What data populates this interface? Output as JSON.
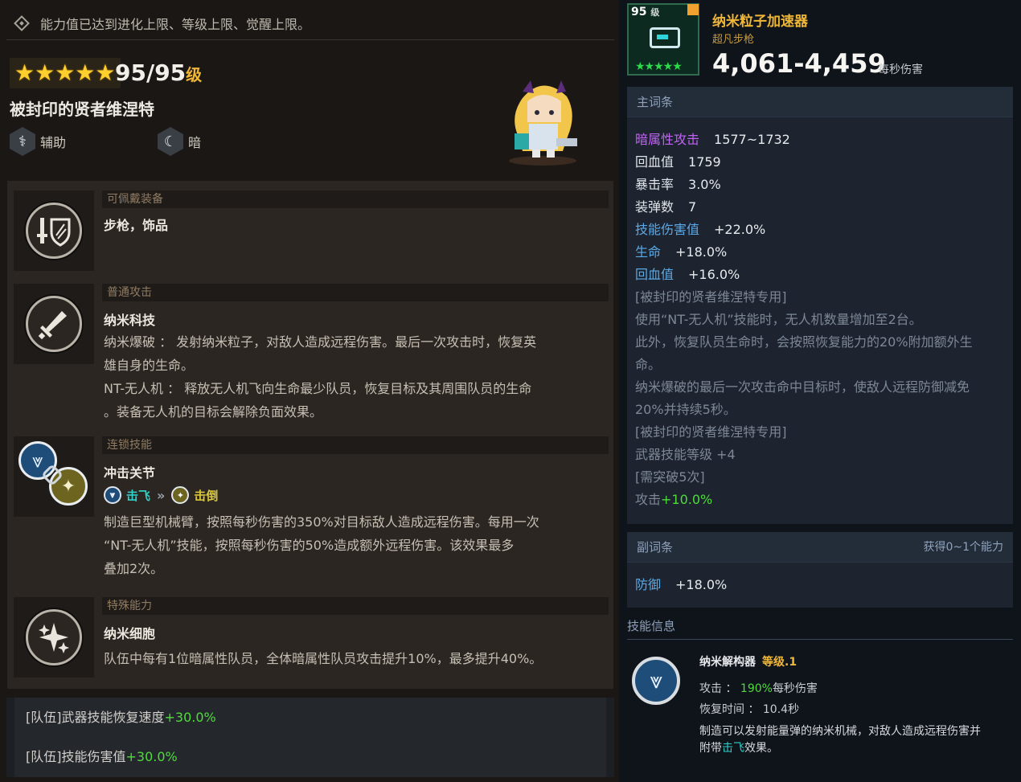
{
  "notice": "能力值已达到进化上限、等级上限、觉醒上限。",
  "hero": {
    "stars": "★★★★★",
    "level": "95/95",
    "level_unit": "级",
    "name": "被封印的贤者维涅特",
    "tags": [
      {
        "label": "辅助",
        "icon": "support-role-icon"
      },
      {
        "label": "暗",
        "icon": "dark-element-icon"
      }
    ]
  },
  "skills": [
    {
      "category": "可佩戴装备",
      "icon": "sword-shield-icon",
      "lines": [
        "步枪，饰品"
      ]
    },
    {
      "category": "普通攻击",
      "icon": "sword-icon",
      "title": "纳米科技",
      "lines": [
        "纳米爆破 ： 发射纳米粒子，对敌人造成远程伤害。最后一次攻击时，恢复英",
        "雄自身的生命。",
        "NT-无人机 ： 释放无人机飞向生命最少队员，恢复目标及其周围队员的生命",
        "。装备无人机的目标会解除负面效果。"
      ]
    },
    {
      "category": "连锁技能",
      "icon": "chain-skill-icon",
      "title": "冲击关节",
      "chain_from": "击飞",
      "chain_to": "击倒",
      "lines": [
        "制造巨型机械臂，按照每秒伤害的350%对目标敌人造成远程伤害。每用一次",
        "“NT-无人机”技能，按照每秒伤害的50%造成额外远程伤害。该效果最多",
        "叠加2次。"
      ]
    },
    {
      "category": "特殊能力",
      "icon": "sparkle-icon",
      "title": "纳米细胞",
      "lines": [
        "队伍中每有1位暗属性队员，全体暗属性队员攻击提升10%，最多提升40%。"
      ]
    }
  ],
  "party_bonuses": [
    {
      "label": "[队伍]武器技能恢复速度",
      "value": "+30.0%"
    },
    {
      "label": "[队伍]技能伤害值",
      "value": "+30.0%"
    }
  ],
  "weapon": {
    "level": "95",
    "level_unit": "级",
    "stars": "★★★★★",
    "name": "纳米粒子加速器",
    "type": "超凡步枪",
    "dps": "4,061-4,459",
    "dps_unit": "每秒伤害"
  },
  "main_stats": {
    "header": "主词条",
    "stats": [
      {
        "key": "暗属性攻击",
        "value": "1577~1732"
      },
      {
        "key": "回血值",
        "value": "1759"
      },
      {
        "key": "暴击率",
        "value": "3.0%"
      },
      {
        "key": "装弹数",
        "value": "7"
      },
      {
        "key": "技能伤害值",
        "value": "+22.0%"
      },
      {
        "key": "生命",
        "value": "+18.0%"
      },
      {
        "key": "回血值",
        "value": "+16.0%"
      }
    ],
    "desc": [
      "[被封印的贤者维涅特专用]",
      "使用“NT-无人机”技能时，无人机数量增加至2台。",
      "此外，恢复队员生命时，会按照恢复能力的20%附加额外生",
      "命。",
      "纳米爆破的最后一次攻击命中目标时，使敌人远程防御减免",
      "20%并持续5秒。",
      "[被封印的贤者维涅特专用]",
      "武器技能等级 +4",
      "[需突破5次]"
    ],
    "bonus_label": "攻击",
    "bonus_value": "+10.0%"
  },
  "sub_stats": {
    "header": "副词条",
    "header_right": "获得0~1个能力",
    "stat_key": "防御",
    "stat_value": "+18.0%"
  },
  "skill_info": {
    "header": "技能信息",
    "name": "纳米解构器",
    "level": "等级.1",
    "attack_label": "攻击 ：",
    "attack_value": "190%",
    "attack_unit": "每秒伤害",
    "cooldown": "恢复时间 ： 10.4秒",
    "desc_1": "制造可以发射能量弹的纳米机械，对敌人造成远程伤害并",
    "desc_2a": "附带",
    "desc_2b": "击飞",
    "desc_2c": "效果。"
  },
  "colors": {
    "gold": "#f0b636",
    "green": "#4fdc3b",
    "purple": "#c063f2",
    "blue": "#5aa9e6",
    "cyan": "#2fd0c8"
  }
}
